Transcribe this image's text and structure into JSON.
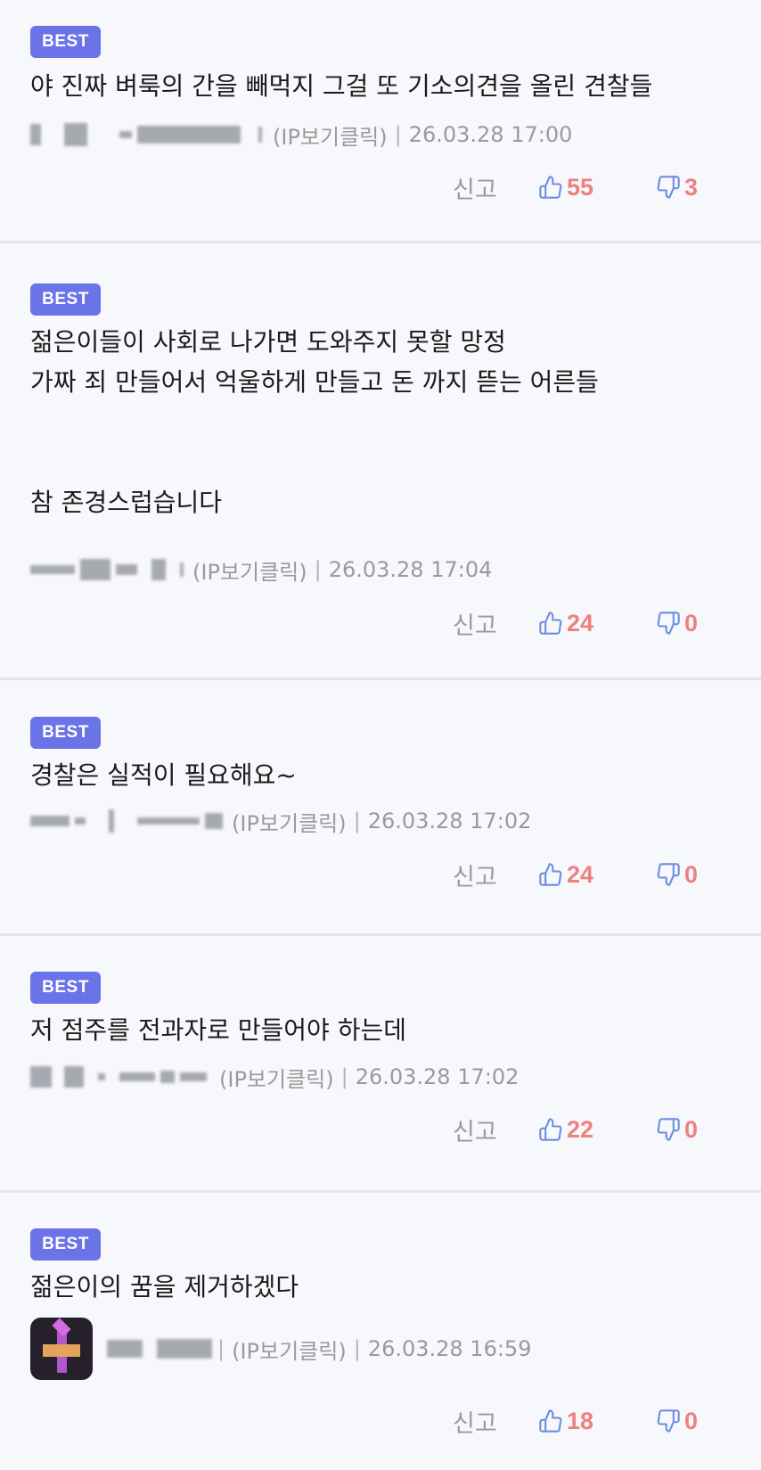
{
  "comments": [
    {
      "badge": "BEST",
      "text": "야 진짜 벼룩의 간을 빼먹지 그걸 또 기소의견을 올린 견찰들",
      "ip": "(IP보기클릭)",
      "date": "26.03.28 17:00",
      "report": "신고",
      "likes": "55",
      "dislikes": "3"
    },
    {
      "badge": "BEST",
      "text": "젊은이들이 사회로 나가면 도와주지 못할 망정\n가짜 죄 만들어서 억울하게 만들고 돈 까지 뜯는 어른들\n\n\n참 존경스럽습니다",
      "ip": "(IP보기클릭)",
      "date": "26.03.28 17:04",
      "report": "신고",
      "likes": "24",
      "dislikes": "0"
    },
    {
      "badge": "BEST",
      "text": "경찰은 실적이 필요해요~",
      "ip": "(IP보기클릭)",
      "date": "26.03.28 17:02",
      "report": "신고",
      "likes": "24",
      "dislikes": "0"
    },
    {
      "badge": "BEST",
      "text": "저 점주를 전과자로 만들어야 하는데",
      "ip": "(IP보기클릭)",
      "date": "26.03.28 17:02",
      "report": "신고",
      "likes": "22",
      "dislikes": "0"
    },
    {
      "badge": "BEST",
      "text": "젊은이의 꿈을 제거하겠다",
      "ip": "(IP보기클릭)",
      "date": "26.03.28 16:59",
      "report": "신고",
      "likes": "18",
      "dislikes": "0"
    }
  ],
  "colors": {
    "badge": "#6b73e8",
    "count": "#ee8080",
    "icon": "#6c8ee0",
    "divider": "#e3e5ec",
    "background": "#f7f8fc"
  },
  "icons": {
    "like": "thumbs-up-icon",
    "dislike": "thumbs-down-icon"
  }
}
